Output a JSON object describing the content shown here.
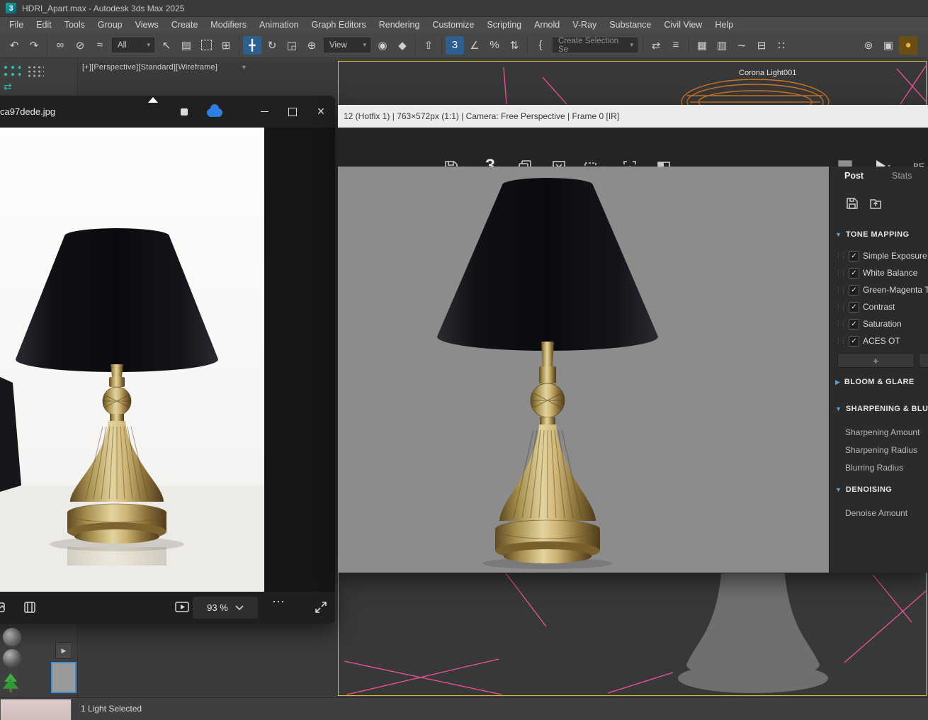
{
  "colors": {
    "accent_yellow": "#d4b63c",
    "wire_pink": "#f0539c",
    "light_orange": "#c8752a",
    "vfb_accent_blue": "#5aa0d8",
    "selection_blue": "#2d5f8f",
    "render_background": "#8c8c8c"
  },
  "icons": {
    "app_logo": "3",
    "undo": "↶",
    "redo": "↷",
    "link": "∞",
    "unlink": "⊘",
    "bind": "≈",
    "select": "↖",
    "select_by_name": "▤",
    "crossing": "⊞",
    "move": "╋",
    "rotate": "↻",
    "scale": "◲",
    "place": "⊕",
    "pivot": "◉",
    "manipulate": "◆",
    "keyboard": "⇧",
    "snap3": "3",
    "angle": "∠",
    "percent": "%",
    "spinner": "⇅",
    "braces": "{",
    "mirror": "⇄",
    "align": "≡",
    "layers": "▦",
    "explorer": "▥",
    "curve": "∼",
    "schematic": "⊟",
    "material": "∷",
    "render_setup": "⊚",
    "render_frame": "▣",
    "render_teapot": "●",
    "dropdown": "▾",
    "tri_down": "▼",
    "tri_right": "▶",
    "check": "✓",
    "handle": "⋮⋮",
    "close": "×",
    "minimize": "–",
    "ellipsis": "⋯",
    "filter": "▼",
    "flyout": "▶",
    "viewport_arrows": "⇄"
  },
  "titlebar": {
    "title": "HDRI_Apart.max - Autodesk 3ds Max 2025"
  },
  "menubar": {
    "items": [
      "File",
      "Edit",
      "Tools",
      "Group",
      "Views",
      "Create",
      "Modifiers",
      "Animation",
      "Graph Editors",
      "Rendering",
      "Customize",
      "Scripting",
      "Arnold",
      "V-Ray",
      "Substance",
      "Civil View",
      "Help"
    ]
  },
  "toolbar": {
    "filter_value": "All",
    "coord_value": "View",
    "selection_set_value": "Create Selection Se"
  },
  "viewport": {
    "label": "[+][Perspective][Standard][Wireframe]",
    "light_label": "Corona Light001"
  },
  "photos": {
    "filename": "ca97dede.jpg",
    "zoom_value": "93 %"
  },
  "vfb": {
    "title": "12 (Hotfix 1) | 763×572px (1:1) | Camera: Free Perspective | Frame 0 [IR]",
    "logo": "3",
    "channel": "BE",
    "tab_post": "Post",
    "tab_stats": "Stats",
    "section_tone_mapping": "TONE MAPPING",
    "tone_ops": [
      "Simple Exposure",
      "White Balance",
      "Green-Magenta Ti",
      "Contrast",
      "Saturation",
      "ACES OT"
    ],
    "add_button": "+",
    "section_bloom": "BLOOM & GLARE",
    "section_sharpening": "SHARPENING & BLU",
    "sharpening_labels": [
      "Sharpening Amount",
      "Sharpening Radius",
      "Blurring Radius"
    ],
    "section_denoising": "DENOISING",
    "denoise_label": "Denoise Amount"
  },
  "statusbar": {
    "text": "1 Light Selected"
  }
}
